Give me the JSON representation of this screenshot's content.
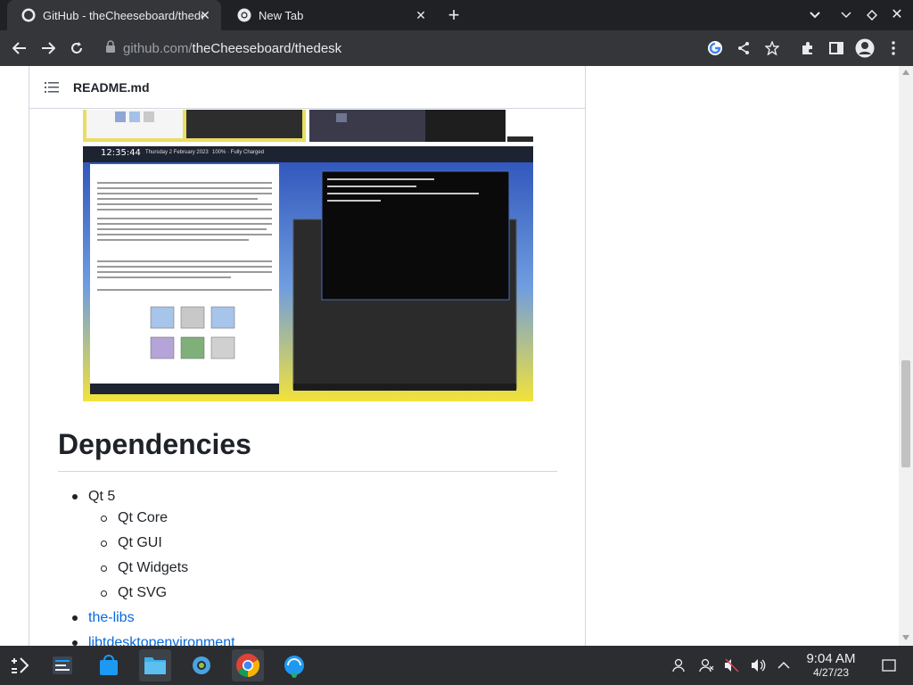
{
  "tabs": [
    {
      "title": "GitHub - theCheeseboard/thedesk",
      "active": true,
      "favicon": "github-icon"
    },
    {
      "title": "New Tab",
      "active": false,
      "favicon": "chrome-icon"
    }
  ],
  "toolbar": {
    "url_host": "github.com/",
    "url_path": "theCheeseboard/thedesk"
  },
  "readme": {
    "filename": "README.md"
  },
  "dependencies": {
    "heading": "Dependencies",
    "items": [
      {
        "label": "Qt 5",
        "level": 1,
        "link": false
      },
      {
        "label": "Qt Core",
        "level": 2,
        "link": false
      },
      {
        "label": "Qt GUI",
        "level": 2,
        "link": false
      },
      {
        "label": "Qt Widgets",
        "level": 2,
        "link": false
      },
      {
        "label": "Qt SVG",
        "level": 2,
        "link": false
      },
      {
        "label": "the-libs",
        "level": 1,
        "link": true
      },
      {
        "label": "libtdesktopenvironment",
        "level": 1,
        "link": true
      }
    ]
  },
  "screenshot_preview": {
    "time": "12:35:44",
    "date_text": "Thursday 2 February 2023",
    "battery": "100% · Fully Charged"
  },
  "taskbar": {
    "time": "9:04 AM",
    "date": "4/27/23"
  },
  "colors": {
    "accent_link": "#0969da",
    "chrome_dark": "#202124",
    "chrome_toolbar": "#35363a"
  }
}
